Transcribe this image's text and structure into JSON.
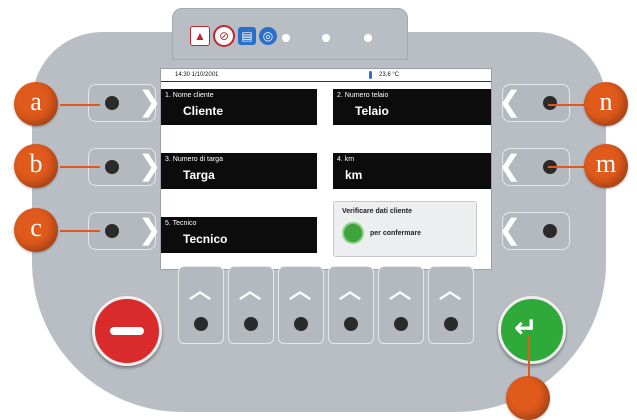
{
  "status": {
    "datetime": "14:30 1/10/2001",
    "temperature": "23,6 °C"
  },
  "fields": {
    "f1": {
      "label": "1. Nome cliente",
      "value": "Cliente"
    },
    "f2": {
      "label": "2. Numero telaio",
      "value": "Telaio"
    },
    "f3": {
      "label": "3. Numero di targa",
      "value": "Targa"
    },
    "f4": {
      "label": "4. km",
      "value": "km"
    },
    "f5": {
      "label": "5. Tecnico",
      "value": "Tecnico"
    }
  },
  "verify": {
    "title": "Verificare dati cliente",
    "confirm_label": "per confermare"
  },
  "callouts": {
    "a": "a",
    "b": "b",
    "c": "c",
    "n": "n",
    "m": "m"
  },
  "colors": {
    "callout": "#e05a1c",
    "cancel": "#d92b2c",
    "confirm": "#2faa3a",
    "device": "#b9bec5"
  },
  "top_icons": [
    "warning-icon",
    "no-entry-icon",
    "document-icon",
    "magnifier-icon"
  ]
}
